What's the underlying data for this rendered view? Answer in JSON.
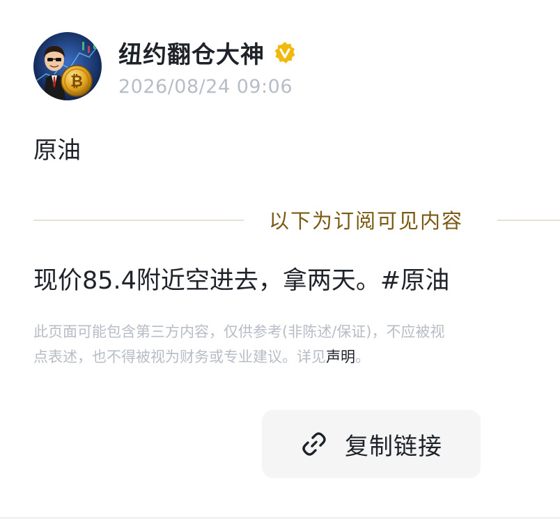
{
  "author": {
    "name": "纽约翻仓大神",
    "verified_icon": "verified-badge-icon",
    "timestamp": "2026/08/24 09:06",
    "avatar_icon": "avatar-image"
  },
  "post": {
    "title": "原油",
    "subscriber_divider": "以下为订阅可见内容",
    "body": "现价85.4附近空进去，拿两天。#原油"
  },
  "disclaimer": {
    "line1": "此页面可能包含第三方内容，仅供参考(非陈述/保证)，不应被视",
    "line2_prefix": "点表述，也不得被视为财务或专业建议。详见",
    "link_text": "声明",
    "line2_suffix": "。"
  },
  "actions": {
    "copy_link_label": "复制链接",
    "copy_link_icon": "link-icon"
  },
  "colors": {
    "verified": "#f0b90b",
    "divider_text": "#7a5a12",
    "muted": "#b7bdc6",
    "text": "#1e2329",
    "button_bg": "#f5f5f5"
  }
}
